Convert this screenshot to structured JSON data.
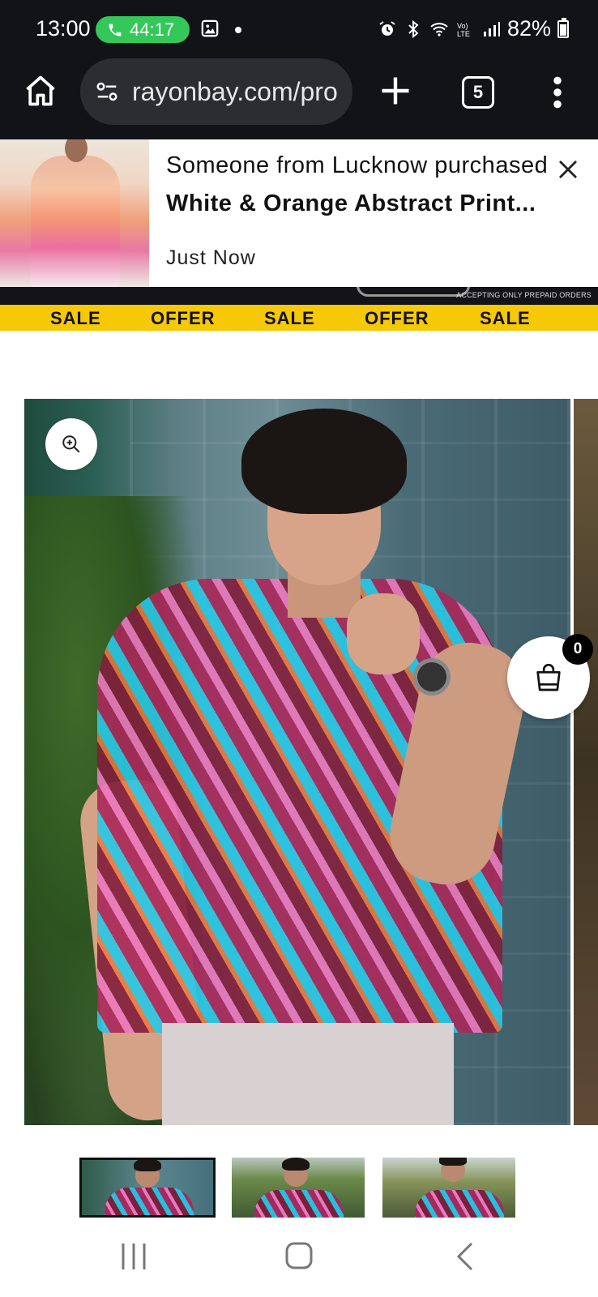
{
  "status_bar": {
    "time": "13:00",
    "call_timer": "44:17",
    "battery": "82%",
    "icons": [
      "phone-icon",
      "gallery-icon",
      "alarm-icon",
      "bluetooth-icon",
      "wifi-icon",
      "volte-icon",
      "signal-icon",
      "battery-icon"
    ]
  },
  "browser": {
    "url": "rayonbay.com/pro",
    "tab_count": "5",
    "icons": [
      "home-icon",
      "site-settings-icon",
      "new-tab-icon",
      "overflow-menu-icon"
    ]
  },
  "notification": {
    "line1": "Someone from Lucknow purchased",
    "product": "White & Orange Abstract Print...",
    "time": "Just Now"
  },
  "promo": {
    "note": "ACCEPTING ONLY PREPAID ORDERS",
    "strip": [
      "SALE",
      "OFFER",
      "SALE",
      "OFFER",
      "SALE"
    ],
    "strip_color": "#f5c808"
  },
  "product": {
    "cart_count": "0"
  },
  "thumbnails": {
    "count": 3,
    "selected": 1
  }
}
